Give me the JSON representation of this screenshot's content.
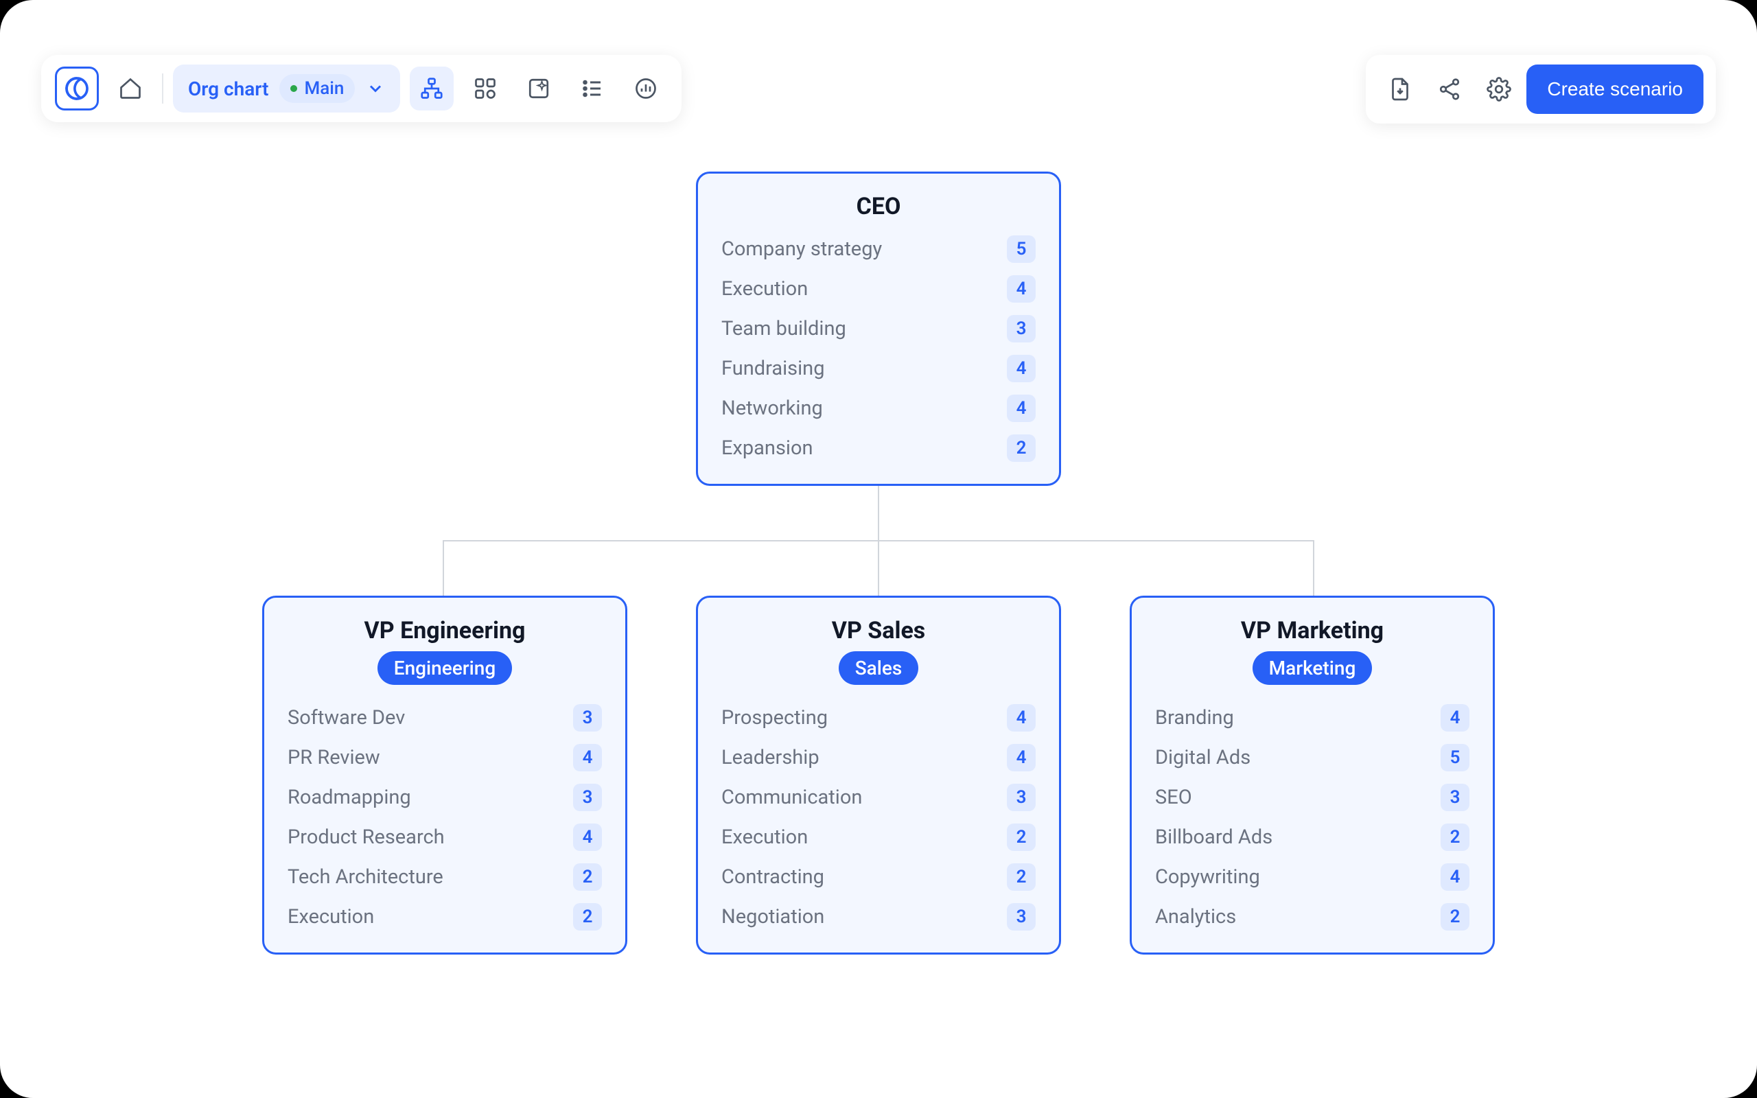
{
  "toolbar": {
    "org_chart_label": "Org chart",
    "main_label": "Main",
    "create_scenario_label": "Create scenario"
  },
  "org": {
    "root": {
      "title": "CEO",
      "skills": [
        {
          "label": "Company strategy",
          "score": "5"
        },
        {
          "label": "Execution",
          "score": "4"
        },
        {
          "label": "Team building",
          "score": "3"
        },
        {
          "label": "Fundraising",
          "score": "4"
        },
        {
          "label": "Networking",
          "score": "4"
        },
        {
          "label": "Expansion",
          "score": "2"
        }
      ]
    },
    "children": [
      {
        "title": "VP Engineering",
        "dept": "Engineering",
        "skills": [
          {
            "label": "Software Dev",
            "score": "3"
          },
          {
            "label": "PR Review",
            "score": "4"
          },
          {
            "label": "Roadmapping",
            "score": "3"
          },
          {
            "label": "Product Research",
            "score": "4"
          },
          {
            "label": "Tech Architecture",
            "score": "2"
          },
          {
            "label": "Execution",
            "score": "2"
          }
        ]
      },
      {
        "title": "VP Sales",
        "dept": "Sales",
        "skills": [
          {
            "label": "Prospecting",
            "score": "4"
          },
          {
            "label": "Leadership",
            "score": "4"
          },
          {
            "label": "Communication",
            "score": "3"
          },
          {
            "label": "Execution",
            "score": "2"
          },
          {
            "label": "Contracting",
            "score": "2"
          },
          {
            "label": "Negotiation",
            "score": "3"
          }
        ]
      },
      {
        "title": "VP Marketing",
        "dept": "Marketing",
        "skills": [
          {
            "label": "Branding",
            "score": "4"
          },
          {
            "label": "Digital Ads",
            "score": "5"
          },
          {
            "label": "SEO",
            "score": "3"
          },
          {
            "label": "Billboard Ads",
            "score": "2"
          },
          {
            "label": "Copywriting",
            "score": "4"
          },
          {
            "label": "Analytics",
            "score": "2"
          }
        ]
      }
    ]
  }
}
